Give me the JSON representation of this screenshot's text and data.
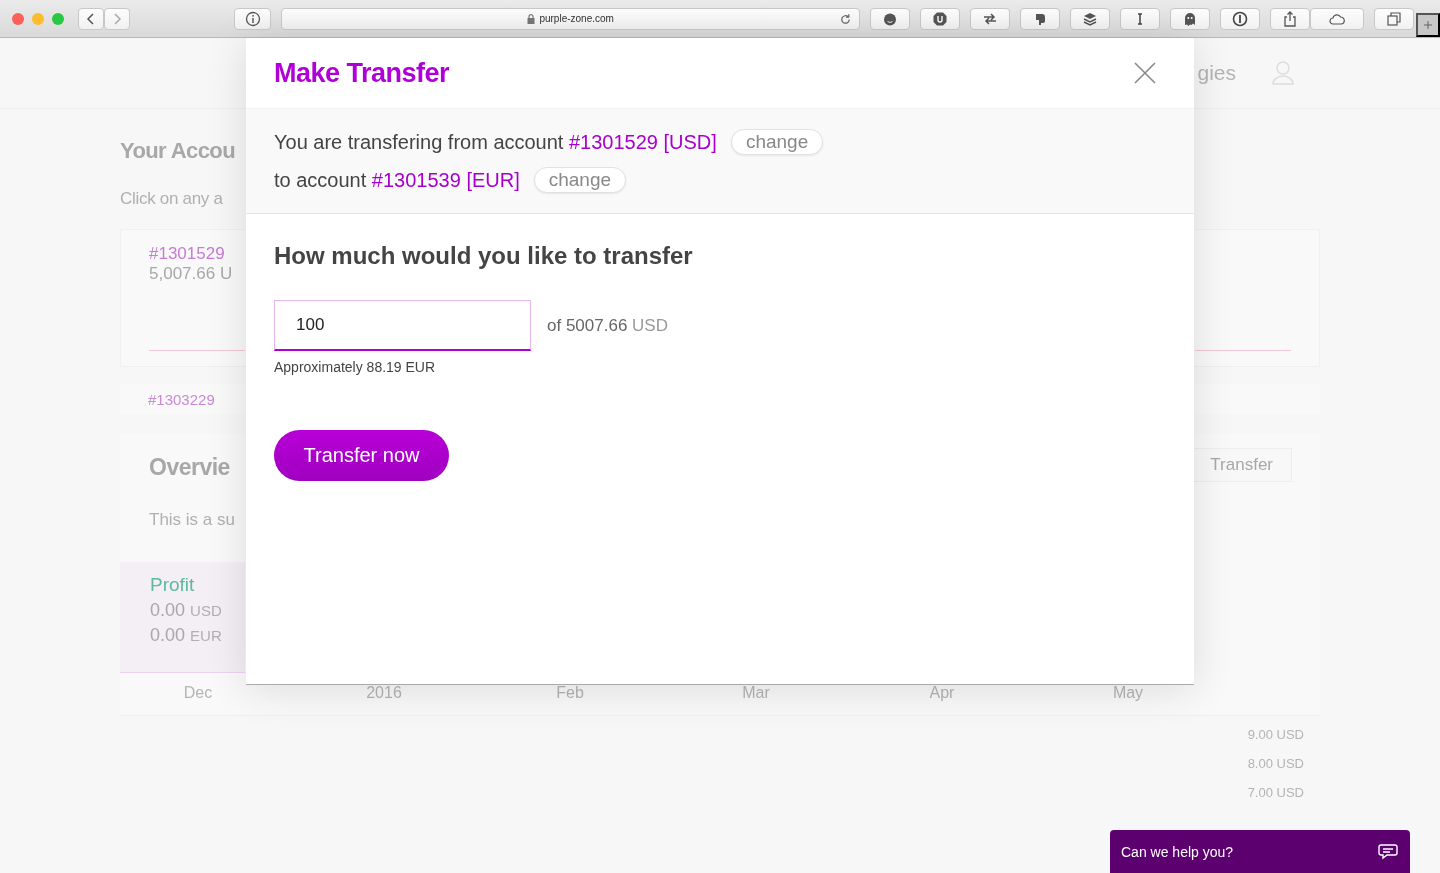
{
  "browser": {
    "url": "purple-zone.com"
  },
  "background": {
    "nav_partial": "gies",
    "title": "Your Accou",
    "subtitle": "Click on any a",
    "accounts": [
      {
        "number": "#1301529",
        "balance": "5,007.66",
        "currency_partial": "U"
      },
      {
        "number": "#1303229"
      }
    ],
    "overview": {
      "title": "Overvie",
      "text": "This is a su",
      "transfer_button": "Transfer",
      "profit": {
        "label": "Profit",
        "rows": [
          {
            "amount": "0.00",
            "currency": "USD"
          },
          {
            "amount": "0.00",
            "currency": "EUR"
          }
        ]
      },
      "months": [
        "Dec",
        "2016",
        "Feb",
        "Mar",
        "Apr",
        "May"
      ],
      "axis_labels": [
        "9.00 USD",
        "8.00 USD",
        "7.00 USD"
      ]
    }
  },
  "modal": {
    "title": "Make Transfer",
    "from": {
      "text": "You are transfering from account",
      "account": "#1301529 [USD]",
      "change": "change"
    },
    "to": {
      "text": "to account",
      "account": "#1301539 [EUR]",
      "change": "change"
    },
    "question": "How much would you like to transfer",
    "amount": {
      "value": "100",
      "of": "of 5007.66",
      "currency": "USD"
    },
    "approx": "Approximately 88.19 EUR",
    "button": "Transfer now"
  },
  "chat": {
    "label": "Can we help you?"
  }
}
